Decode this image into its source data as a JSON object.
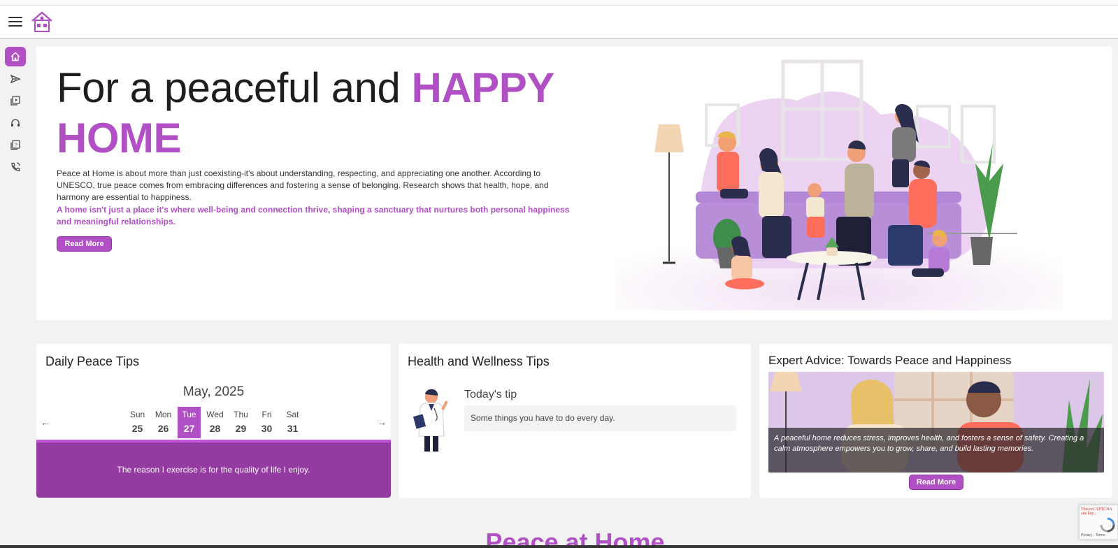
{
  "header": {
    "menu_icon": "hamburger-icon",
    "logo_icon": "house-logo-icon"
  },
  "sidebar": {
    "items": [
      {
        "icon": "home-icon",
        "active": true
      },
      {
        "icon": "paper-plane-icon",
        "active": false
      },
      {
        "icon": "video-library-icon",
        "active": false
      },
      {
        "icon": "headset-icon",
        "active": false
      },
      {
        "icon": "help-book-icon",
        "active": false
      },
      {
        "icon": "phone-icon",
        "active": false
      }
    ]
  },
  "hero": {
    "title_plain": "For a peaceful and ",
    "title_accent": "HAPPY HOME",
    "description": "Peace at Home is about more than just coexisting-it's about understanding, respecting, and appreciating one another. According to UNESCO, true peace comes from embracing differences and fostering a sense of belonging. Research shows that health, hope, and harmony are essential to happiness.",
    "highlight": "A home isn't just a place it's where well-being and connection thrive, shaping a sanctuary that nurtures both personal happiness and meaningful relationships.",
    "read_more": "Read More",
    "accent_color": "#b14fc5"
  },
  "daily_tips": {
    "title": "Daily Peace Tips",
    "month": "May, 2025",
    "days": [
      {
        "name": "Sun",
        "date": "25"
      },
      {
        "name": "Mon",
        "date": "26"
      },
      {
        "name": "Tue",
        "date": "27",
        "selected": true
      },
      {
        "name": "Wed",
        "date": "28"
      },
      {
        "name": "Thu",
        "date": "29"
      },
      {
        "name": "Fri",
        "date": "30"
      },
      {
        "name": "Sat",
        "date": "31"
      }
    ],
    "prev_arrow": "←",
    "next_arrow": "→",
    "quote": "The reason I exercise is for the quality of life I enjoy.",
    "quote_bg": "#933ba0"
  },
  "health": {
    "title": "Health and Wellness Tips",
    "tip_label": "Today's tip",
    "tip_text": "Some things you have to do every day."
  },
  "expert": {
    "title": "Expert Advice: Towards Peace and Happiness",
    "caption": "A peaceful home reduces stress, improves health, and fosters a sense of safety. Creating a calm atmosphere empowers you to grow, share, and build lasting memories.",
    "read_more": "Read More"
  },
  "recaptcha": {
    "warning": "This reCAPTCHA site key...",
    "terms": "Privacy - Terms"
  },
  "section": {
    "title": "Peace at Home"
  }
}
